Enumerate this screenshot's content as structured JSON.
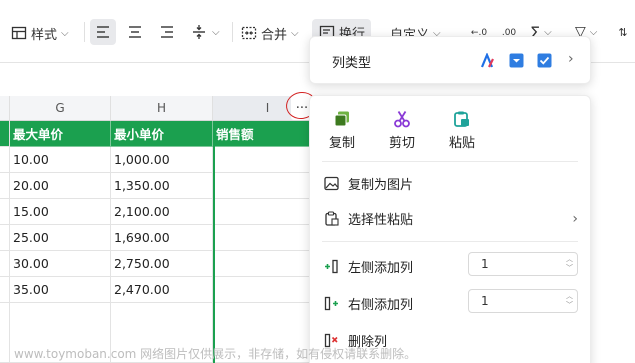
{
  "toolbar": {
    "style_label": "样式",
    "merge_label": "合并",
    "wrap_label": "换行",
    "number_format_label": "自定义",
    "sum_symbol": "Σ",
    "filter_symbol": "▽"
  },
  "grid": {
    "columns": [
      "G",
      "H",
      "I"
    ],
    "headers": [
      "最大单价",
      "最小单价",
      "销售额"
    ],
    "rows": [
      [
        "10.00",
        "1,000.00",
        ""
      ],
      [
        "20.00",
        "1,350.00",
        ""
      ],
      [
        "15.00",
        "2,100.00",
        ""
      ],
      [
        "25.00",
        "1,690.00",
        ""
      ],
      [
        "30.00",
        "2,750.00",
        ""
      ],
      [
        "35.00",
        "2,470.00",
        ""
      ]
    ],
    "more_button": "···",
    "accent_color": "#1ba04f"
  },
  "column_type_menu": {
    "label": "列类型"
  },
  "context_menu": {
    "copy": "复制",
    "cut": "剪切",
    "paste": "粘贴",
    "copy_as_image": "复制为图片",
    "paste_special": "选择性粘贴",
    "insert_left": "左侧添加列",
    "insert_left_count": "1",
    "insert_right": "右侧添加列",
    "insert_right_count": "1",
    "delete_column": "删除列"
  },
  "watermark": "www.toymoban.com 网络图片仅供展示，非存储，如有侵权请联系删除。"
}
